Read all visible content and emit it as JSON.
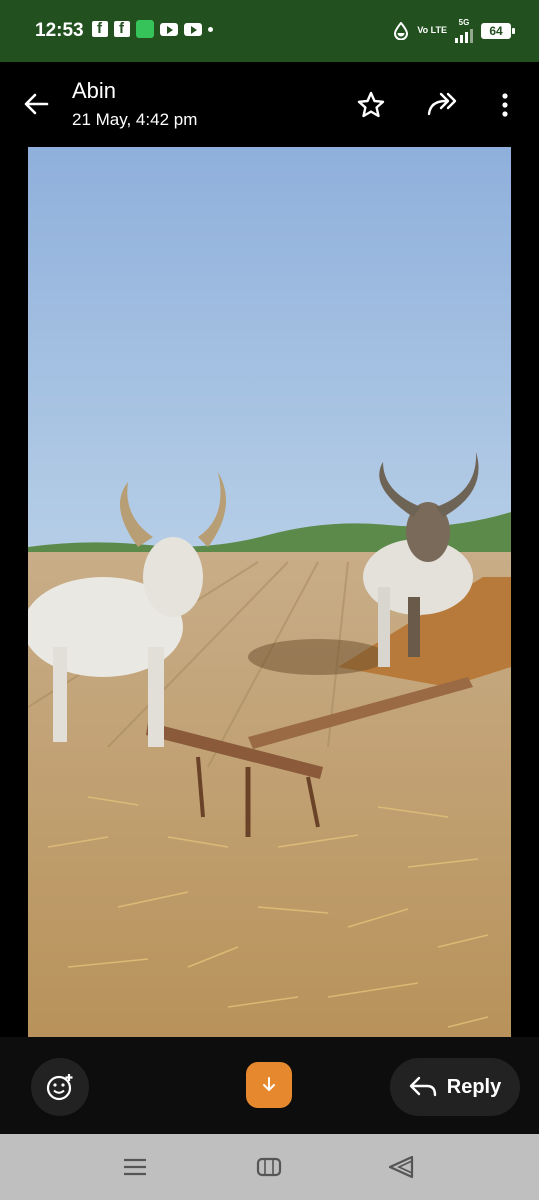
{
  "status_bar": {
    "time": "12:53",
    "network_label": "Vo LTE",
    "network_type": "5G",
    "battery": "64",
    "notification_icons": [
      "facebook-icon",
      "facebook-icon",
      "app-icon",
      "youtube-icon",
      "youtube-icon",
      "more-dot"
    ]
  },
  "header": {
    "sender": "Abin",
    "timestamp": "21 May, 4:42 pm",
    "icons": [
      "back-arrow-icon",
      "star-icon",
      "forward-icon",
      "more-vert-icon"
    ]
  },
  "image": {
    "subject": "two-bulls-with-plough-in-field"
  },
  "bottom_bar": {
    "reply_label": "Reply",
    "icons": [
      "emoji-add-icon",
      "download-icon",
      "reply-icon"
    ]
  },
  "nav_bar": {
    "icons": [
      "recents-icon",
      "home-icon",
      "back-icon"
    ]
  },
  "colors": {
    "status_bar_bg": "#22501f",
    "accent": "#e6892e",
    "nav_bg": "#bfbfbf"
  }
}
